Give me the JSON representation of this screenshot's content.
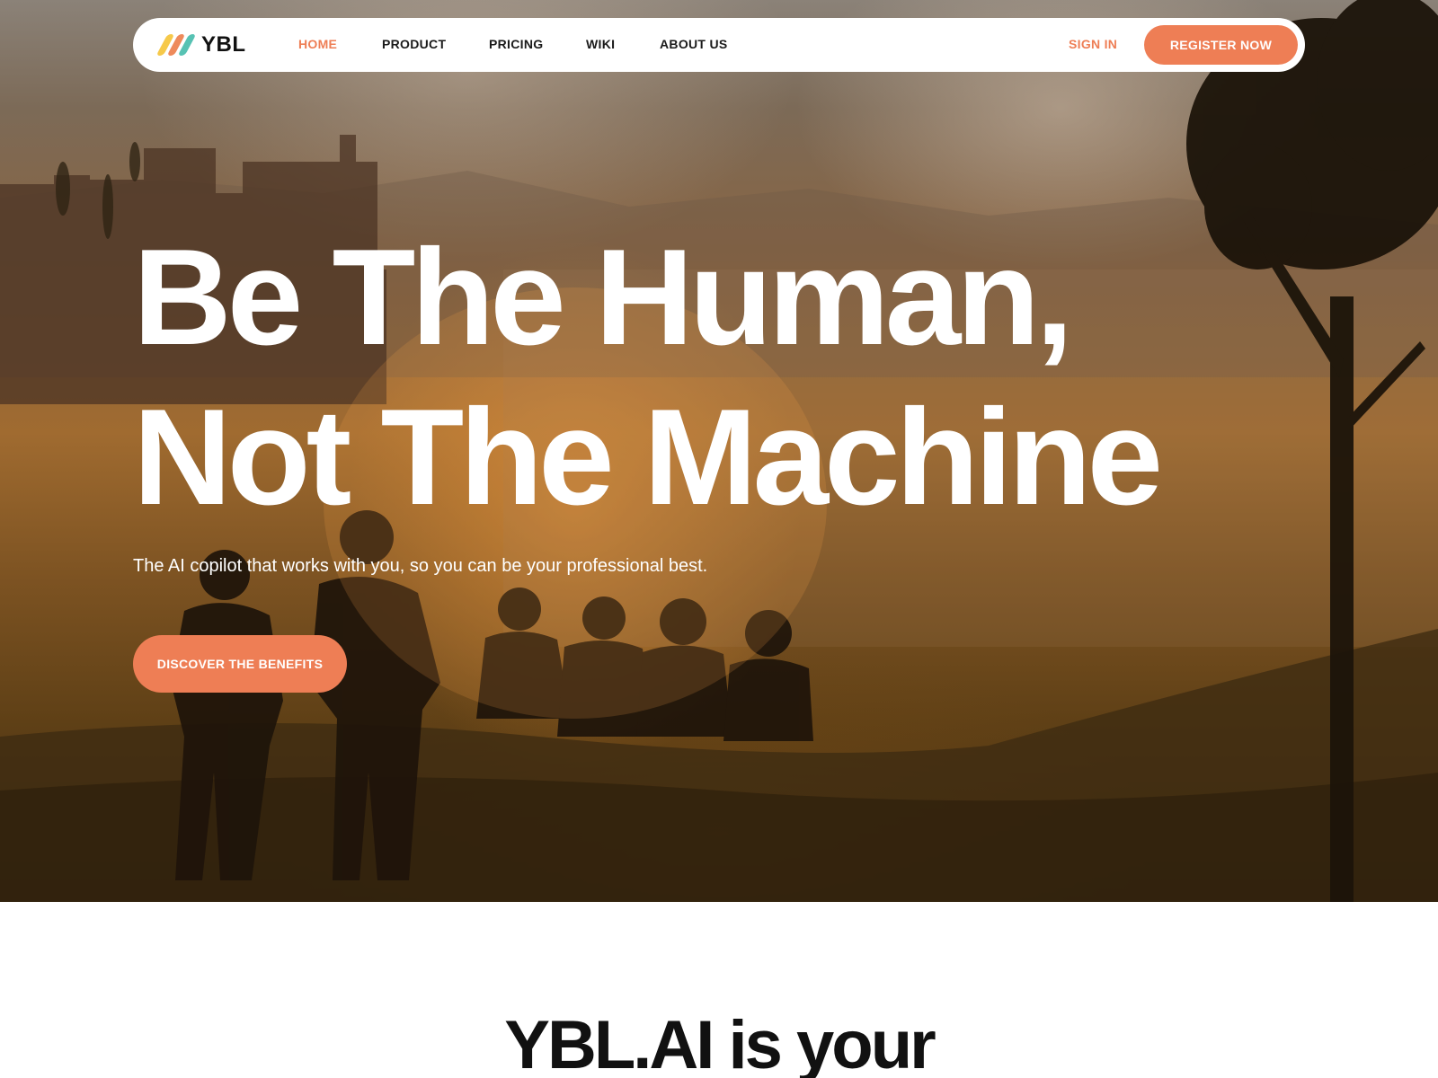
{
  "brand": {
    "name": "YBL",
    "colors": {
      "accent": "#ee7e55",
      "yellow": "#f6c94a",
      "teal": "#57c2b3"
    }
  },
  "nav": {
    "items": [
      {
        "label": "HOME",
        "active": true
      },
      {
        "label": "PRODUCT",
        "active": false
      },
      {
        "label": "PRICING",
        "active": false
      },
      {
        "label": "WIKI",
        "active": false
      },
      {
        "label": "ABOUT US",
        "active": false
      }
    ],
    "sign_in": "SIGN IN",
    "register": "REGISTER NOW"
  },
  "hero": {
    "headline_line1": "Be The Human,",
    "headline_line2": "Not The Machine",
    "subtitle": "The AI copilot that works with you, so you can be your professional best.",
    "cta": "DISCOVER THE BENEFITS"
  },
  "section": {
    "title": "YBL.AI is your"
  }
}
